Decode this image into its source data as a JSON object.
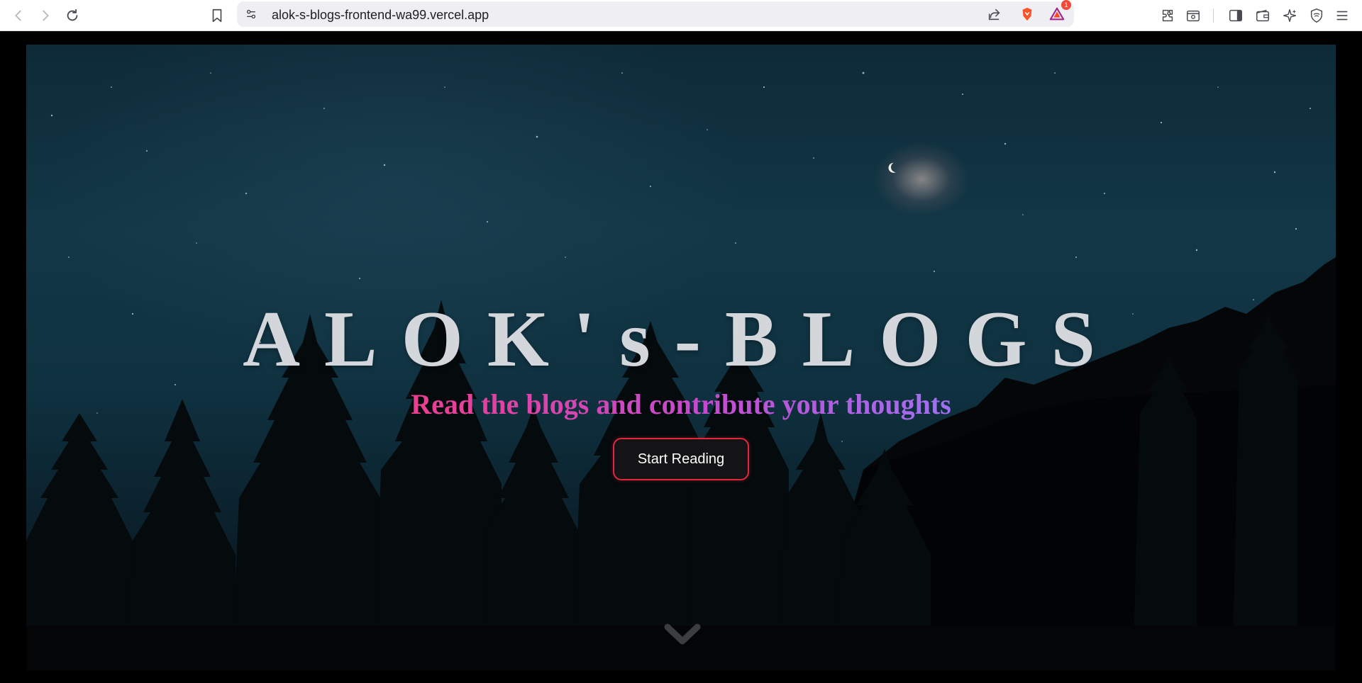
{
  "browser": {
    "url": "alok-s-blogs-frontend-wa99.vercel.app",
    "notification_count": "1",
    "icons": [
      "back-icon",
      "forward-icon",
      "reload-icon",
      "bookmark-icon",
      "site-settings-icon",
      "share-icon",
      "brave-shields-icon",
      "brave-rewards-icon",
      "extensions-icon",
      "reader-mode-icon",
      "sidebar-icon",
      "wallet-icon",
      "leo-ai-icon",
      "vpn-icon",
      "menu-icon"
    ]
  },
  "hero": {
    "title": "ALOK's-BLOGS",
    "subtitle": "Read the blogs and contribute your thoughts",
    "cta_label": "Start Reading",
    "scroll_icon": "chevron-down-icon"
  },
  "colors": {
    "cta_border": "#e0283a",
    "subtitle_gradient_start": "#ea3f8f",
    "subtitle_gradient_end": "#a070f0",
    "title_color": "#d3d6da"
  }
}
